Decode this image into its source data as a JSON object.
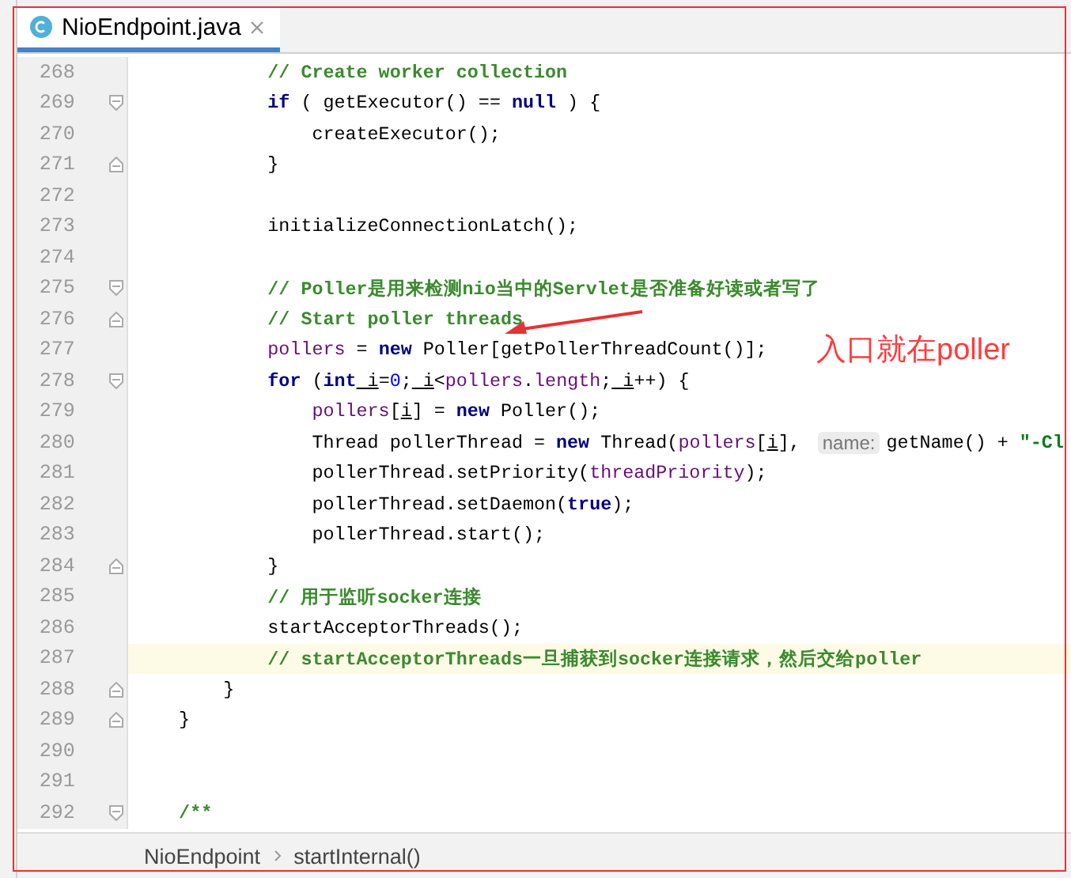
{
  "tab": {
    "title": "NioEndpoint.java",
    "selected": true
  },
  "code_lines": [
    {
      "number": "268",
      "kind": "plain",
      "current": false,
      "tokens": [
        {
          "kind": "comment",
          "text": "            // Create worker collection"
        }
      ]
    },
    {
      "number": "269",
      "kind": "foldstart",
      "current": false,
      "tokens": [
        {
          "kind": "keyword",
          "text": "            if"
        },
        {
          "kind": "plain",
          "text": " ( getExecutor() == "
        },
        {
          "kind": "keyword",
          "text": "null"
        },
        {
          "kind": "plain",
          "text": " ) {"
        }
      ]
    },
    {
      "number": "270",
      "kind": "plain",
      "current": false,
      "tokens": [
        {
          "kind": "plain",
          "text": "                createExecutor();"
        }
      ]
    },
    {
      "number": "271",
      "kind": "foldend",
      "current": false,
      "tokens": [
        {
          "kind": "plain",
          "text": "            }"
        }
      ]
    },
    {
      "number": "272",
      "kind": "plain",
      "current": false
    },
    {
      "number": "273",
      "kind": "plain",
      "current": false,
      "tokens": [
        {
          "kind": "plain",
          "text": "            initializeConnectionLatch();"
        }
      ]
    },
    {
      "number": "274",
      "kind": "plain",
      "current": false
    },
    {
      "number": "275",
      "kind": "foldstart",
      "current": false,
      "tokens": [
        {
          "kind": "comment",
          "text": "            // Poller是用来检测nio当中的Servlet是否准备好读或者写了"
        }
      ]
    },
    {
      "number": "276",
      "kind": "foldend",
      "current": false,
      "tokens": [
        {
          "kind": "comment",
          "text": "            // Start poller threads"
        }
      ]
    },
    {
      "number": "277",
      "kind": "plain",
      "current": false,
      "tokens": [
        {
          "kind": "field",
          "text": "            pollers"
        },
        {
          "kind": "plain",
          "text": " = "
        },
        {
          "kind": "keyword",
          "text": "new"
        },
        {
          "kind": "plain",
          "text": " Poller[getPollerThreadCount()];"
        }
      ]
    },
    {
      "number": "278",
      "kind": "foldstart",
      "current": false,
      "tokens": [
        {
          "kind": "keyword",
          "text": "            for"
        },
        {
          "kind": "plain",
          "text": " ("
        },
        {
          "kind": "keyword",
          "text": "int"
        },
        {
          "kind": "local",
          "text": " i"
        },
        {
          "kind": "plain",
          "text": "="
        },
        {
          "kind": "number",
          "text": "0"
        },
        {
          "kind": "plain",
          "text": ";"
        },
        {
          "kind": "local",
          "text": " i"
        },
        {
          "kind": "plain",
          "text": "<"
        },
        {
          "kind": "field",
          "text": "pollers"
        },
        {
          "kind": "plain",
          "text": "."
        },
        {
          "kind": "field",
          "text": "length"
        },
        {
          "kind": "plain",
          "text": ";"
        },
        {
          "kind": "local",
          "text": " i"
        },
        {
          "kind": "plain",
          "text": "++) {"
        }
      ]
    },
    {
      "number": "279",
      "kind": "plain",
      "current": false,
      "tokens": [
        {
          "kind": "field",
          "text": "                pollers"
        },
        {
          "kind": "plain",
          "text": "["
        },
        {
          "kind": "local",
          "text": "i"
        },
        {
          "kind": "plain",
          "text": "] = "
        },
        {
          "kind": "keyword",
          "text": "new"
        },
        {
          "kind": "plain",
          "text": " Poller();"
        }
      ]
    },
    {
      "number": "280",
      "kind": "plain",
      "current": false,
      "tokens": [
        {
          "kind": "plain",
          "text": "                Thread pollerThread = "
        },
        {
          "kind": "keyword",
          "text": "new"
        },
        {
          "kind": "plain",
          "text": " Thread("
        },
        {
          "kind": "field",
          "text": "pollers"
        },
        {
          "kind": "plain",
          "text": "["
        },
        {
          "kind": "local",
          "text": "i"
        },
        {
          "kind": "plain",
          "text": "], "
        },
        {
          "kind": "hint",
          "text": "name:"
        },
        {
          "kind": "plain",
          "text": "getName() + "
        },
        {
          "kind": "string",
          "text": "\"-Cl"
        }
      ]
    },
    {
      "number": "281",
      "kind": "plain",
      "current": false,
      "tokens": [
        {
          "kind": "plain",
          "text": "                pollerThread.setPriority("
        },
        {
          "kind": "field",
          "text": "threadPriority"
        },
        {
          "kind": "plain",
          "text": ");"
        }
      ]
    },
    {
      "number": "282",
      "kind": "plain",
      "current": false,
      "tokens": [
        {
          "kind": "plain",
          "text": "                pollerThread.setDaemon("
        },
        {
          "kind": "keyword",
          "text": "true"
        },
        {
          "kind": "plain",
          "text": ");"
        }
      ]
    },
    {
      "number": "283",
      "kind": "plain",
      "current": false,
      "tokens": [
        {
          "kind": "plain",
          "text": "                pollerThread.start();"
        }
      ]
    },
    {
      "number": "284",
      "kind": "foldend",
      "current": false,
      "tokens": [
        {
          "kind": "plain",
          "text": "            }"
        }
      ]
    },
    {
      "number": "285",
      "kind": "plain",
      "current": false,
      "tokens": [
        {
          "kind": "comment",
          "text": "            // 用于监听socker连接"
        }
      ]
    },
    {
      "number": "286",
      "kind": "plain",
      "current": false,
      "tokens": [
        {
          "kind": "plain",
          "text": "            startAcceptorThreads();"
        }
      ]
    },
    {
      "number": "287",
      "kind": "plain",
      "current": true,
      "tokens": [
        {
          "kind": "comment",
          "text": "            // startAcceptorThreads一旦捕获到socker连接请求，然后交给poller"
        }
      ]
    },
    {
      "number": "288",
      "kind": "foldend",
      "current": false,
      "tokens": [
        {
          "kind": "plain",
          "text": "        }"
        }
      ]
    },
    {
      "number": "289",
      "kind": "foldend",
      "current": false,
      "tokens": [
        {
          "kind": "plain",
          "text": "    }"
        }
      ]
    },
    {
      "number": "290",
      "kind": "plain",
      "current": false
    },
    {
      "number": "291",
      "kind": "plain",
      "current": false
    },
    {
      "number": "292",
      "kind": "foldstart",
      "current": false,
      "tokens": [
        {
          "kind": "comment",
          "text": "    /**"
        }
      ]
    }
  ],
  "annotation": {
    "text": "入口就在poller"
  },
  "breadcrumb": [
    "NioEndpoint",
    "startInternal()"
  ]
}
